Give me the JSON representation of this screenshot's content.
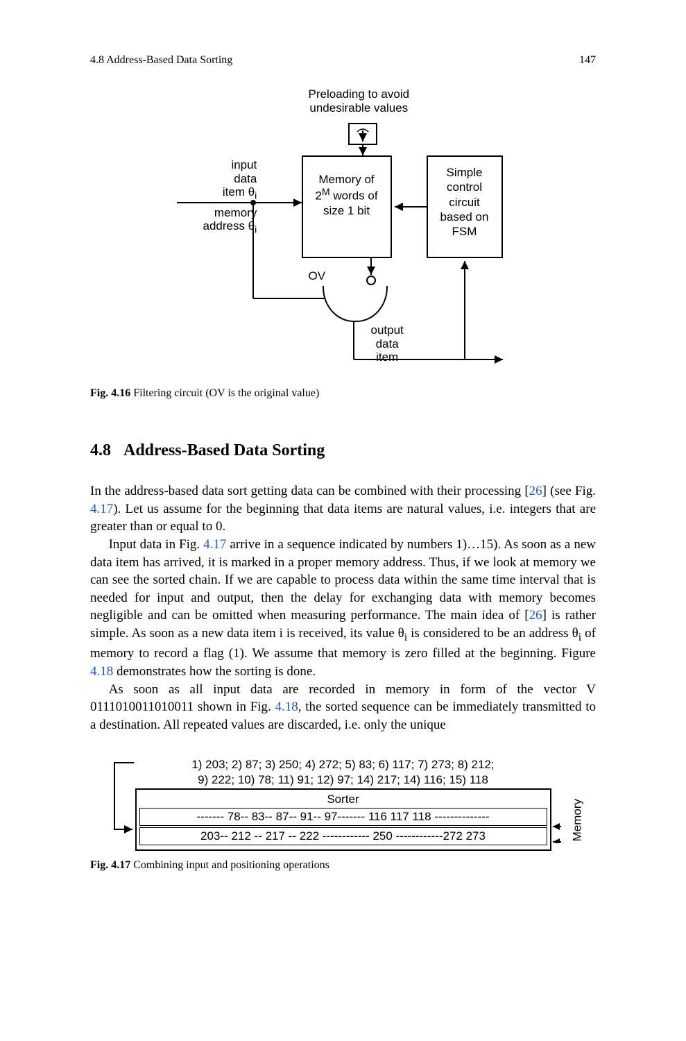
{
  "header": {
    "left": "4.8  Address-Based Data Sorting",
    "pagenum": "147"
  },
  "fig416": {
    "preload1": "Preloading to avoid",
    "preload2": "undesirable values",
    "in1": "input",
    "in2": "data",
    "in3": "item θ",
    "in3sub": "i",
    "in4": "memory",
    "in5": "address θ",
    "in5sub": "i",
    "mem1": "Memory of",
    "mem2": "2",
    "mem2sup": "M",
    "mem2b": " words of",
    "mem3": "size 1 bit",
    "ctrl1": "Simple",
    "ctrl2": "control",
    "ctrl3": "circuit",
    "ctrl4": "based on",
    "ctrl5": "FSM",
    "ov": "OV",
    "out1": "output",
    "out2": "data",
    "out3": "item",
    "caption_b": "Fig. 4.16",
    "caption_t": "  Filtering circuit (OV is the original value)"
  },
  "section": {
    "num": "4.8",
    "title": "Address-Based Data Sorting"
  },
  "para1": {
    "t1": "In the address-based data sort getting data can be combined with their processing [",
    "ref26a": "26",
    "t2": "] (see Fig. ",
    "ref417a": "4.17",
    "t3": "). Let us assume for the beginning that data items are natural values, i.e. integers that are greater than or equal to 0."
  },
  "para2": {
    "t1": "Input data in Fig. ",
    "ref417b": "4.17",
    "t2": " arrive in a sequence indicated by numbers 1)…15). As soon as a new data item has arrived, it is marked in a proper memory address. Thus, if we look at memory we can see the sorted chain. If we are capable to process data within the same time interval that is needed for input and output, then the delay for exchanging data with memory becomes negligible and can be omitted when measuring performance. The main idea of [",
    "ref26b": "26",
    "t3": "] is rather simple. As soon as a new data item i is received, its value θ",
    "sub_i1": "i",
    "t4": " is considered to be an address θ",
    "sub_i2": "i",
    "t5": " of memory to record a flag (1). We assume that memory is zero filled at the beginning. Figure ",
    "ref418a": "4.18",
    "t6": " demonstrates how the sorting is done."
  },
  "para3": {
    "t1": "As soon as all input data are recorded in memory in form of the vector V 0111010011010011 shown in Fig. ",
    "ref418b": "4.18",
    "t2": ", the sorted sequence can be immediately transmitted to a destination. All repeated values are discarded, i.e. only the unique"
  },
  "fig417": {
    "seq1": "1) 203; 2) 87; 3) 250; 4) 272; 5) 83; 6) 117; 7) 273; 8) 212;",
    "seq2": "9)  222; 10) 78; 11) 91; 12) 97; 14) 217; 14) 116;  15) 118",
    "sorter": "Sorter",
    "row1": "------- 78-- 83-- 87-- 91-- 97------- 116 117 118 --------------",
    "row2": "203-- 212 -- 217 --  222  ------------    250  ------------272 273",
    "memory": "Memory",
    "caption_b": "Fig. 4.17",
    "caption_t": "  Combining input and positioning operations"
  }
}
